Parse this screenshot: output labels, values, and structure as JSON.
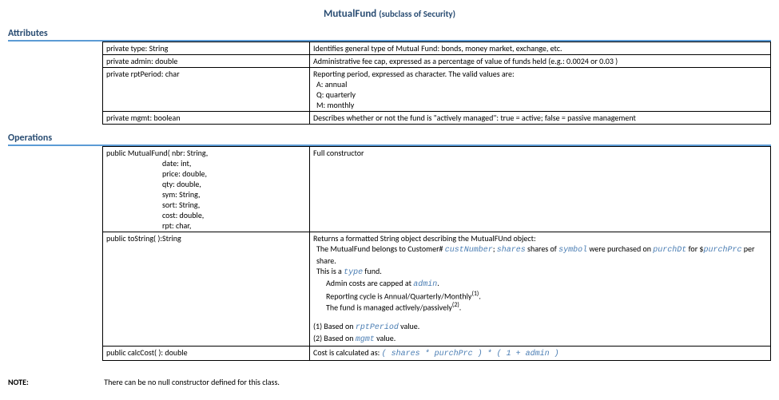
{
  "title_main": "MutualFund",
  "title_sub": "(subclass of  Security)",
  "sections": {
    "attributes_header": "Attributes",
    "operations_header": "Operations"
  },
  "attributes": [
    {
      "sig": "private type: String",
      "desc": "Identifies general type of Mutual Fund: bonds, money market, exchange, etc."
    },
    {
      "sig": "private admin: double",
      "desc": "Administrative fee cap, expressed as a percentage of value of funds held (e.g.: 0.0024 or 0.03 )"
    },
    {
      "sig": "private rptPeriod: char",
      "desc_main": "Reporting period, expressed as  character. The valid values are:",
      "desc_lines": [
        "A: annual",
        "Q: quarterly",
        "M: monthly"
      ]
    },
    {
      "sig": "private mgmt: boolean",
      "desc": "Describes whether or not the fund is \"actively managed\": true = active; false = passive management"
    }
  ],
  "operations": {
    "constructor": {
      "sig_head": "public MutualFund( nbr: String,",
      "params": [
        "date: int,",
        "price: double,",
        "qty: double,",
        "sym: String,",
        "sort: String,",
        "cost: double,",
        "rpt: char,"
      ],
      "desc": "Full constructor"
    },
    "toString": {
      "sig": "public toString( ):String",
      "line1_pre": "Returns a formatted String object describing the MutualFUnd object:",
      "line2_t1": "The MutualFund belongs to Customer# ",
      "v_cust": "custNumber",
      "line2_t2": "; ",
      "v_shares": "shares",
      "line2_t3": " shares of ",
      "v_symbol": "symbol",
      "line2_t4": " were purchased on ",
      "v_date": "purchDt",
      "line2_t5": " for $",
      "v_price": "purchPrc",
      "line2_t6": " per share.",
      "line3_t1": "This is a ",
      "v_type": "type",
      "line3_t2": " fund.",
      "line4_t1": "Admin costs are capped at ",
      "v_admin": "admin",
      "line4_t2": ".",
      "line5": "Reporting cycle is Annual/Quarterly/Monthly",
      "line5_sup": "(1)",
      "line5_end": ".",
      "line6": "The fund is managed actively/passively",
      "line6_sup": "(2)",
      "line6_end": ".",
      "note1_t1": "(1) Based on ",
      "note1_v": "rptPeriod",
      "note1_t2": " value.",
      "note2_t1": "(2) Based on ",
      "note2_v": "mgmt",
      "note2_t2": " value."
    },
    "calcCost": {
      "sig": "public calcCost( ): double",
      "desc_t1": "Cost is calculated as: ",
      "desc_formula": "(  shares * purchPrc ) * ( 1 + admin )"
    }
  },
  "note": {
    "label": "NOTE:",
    "text": "There can be no null constructor defined for this class."
  }
}
